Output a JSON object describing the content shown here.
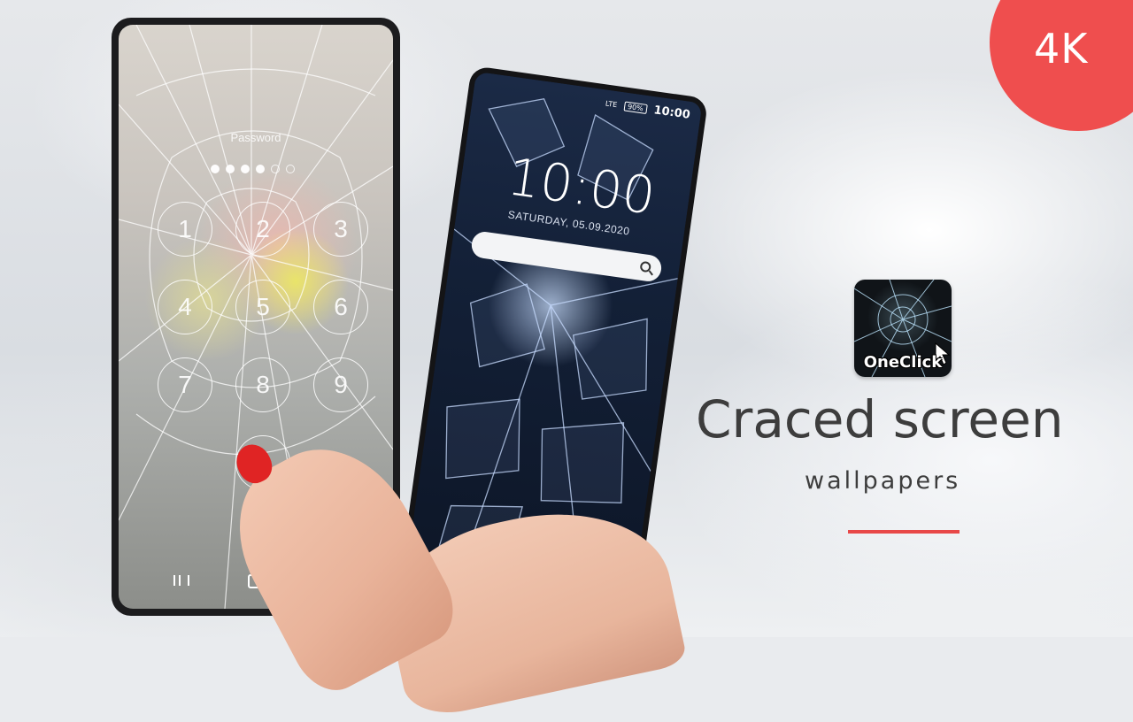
{
  "badge": {
    "label": "4K",
    "color": "#ef4e4e"
  },
  "left_phone": {
    "password_label": "Password",
    "pin_dots_filled": 4,
    "pin_dots_total": 6,
    "keys": [
      "1",
      "2",
      "3",
      "4",
      "5",
      "6",
      "7",
      "8",
      "9"
    ]
  },
  "right_phone": {
    "status_network": "LTE",
    "status_battery": "90%",
    "status_time": "10:00",
    "clock": "10:00",
    "date": "SATURDAY, 05.09.2020"
  },
  "app": {
    "icon_label": "OneClick"
  },
  "headline": {
    "title": "Craced screen",
    "subtitle": "wallpapers",
    "accent": "#e84848"
  }
}
